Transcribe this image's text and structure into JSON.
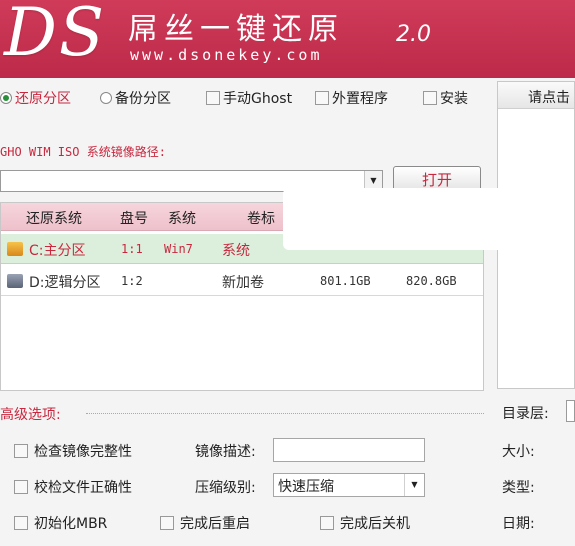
{
  "banner": {
    "logo": "DS",
    "app_title": "屌丝一键还原",
    "website": "www.dsonekey.com",
    "version": "2.0"
  },
  "modes": [
    {
      "label": "还原分区",
      "kind": "radio",
      "checked": true
    },
    {
      "label": "备份分区",
      "kind": "radio",
      "checked": false
    },
    {
      "label": "手动Ghost",
      "kind": "checkbox",
      "checked": false
    },
    {
      "label": "外置程序",
      "kind": "checkbox",
      "checked": false
    },
    {
      "label": "安装",
      "kind": "checkbox",
      "checked": false
    }
  ],
  "right_panel": {
    "title": "请点击"
  },
  "path": {
    "label": "GHO WIM ISO 系统镜像路径:",
    "value": "",
    "open_button": "打开"
  },
  "table": {
    "headers": [
      "还原系统",
      "盘号",
      "系统",
      "卷标"
    ],
    "rows": [
      {
        "name": "C:主分区",
        "disk": "1:1",
        "os": "Win7",
        "label": "系统",
        "size": "",
        "free": "",
        "selected": true,
        "icon": "drive-c-icon"
      },
      {
        "name": "D:逻辑分区",
        "disk": "1:2",
        "os": "",
        "label": "新加卷",
        "size": "801.1GB",
        "free": "820.8GB",
        "selected": false,
        "icon": "drive-d-icon"
      }
    ]
  },
  "advanced": {
    "title": "高级选项:",
    "check_integrity": "检查镜像完整性",
    "check_files": "校检文件正确性",
    "init_mbr": "初始化MBR",
    "restart_after": "完成后重启",
    "shutdown_after": "完成后关机",
    "desc_label": "镜像描述:",
    "desc_value": "",
    "compress_label": "压缩级别:",
    "compress_value": "快速压缩"
  },
  "side_info": {
    "dir_layer": "目录层:",
    "size": "大小:",
    "type": "类型:",
    "date": "日期:"
  },
  "colors": {
    "accent": "#c8283f",
    "banner": "#c3304f",
    "selected_row": "#dcefdc",
    "header_row": "#f2ccd5"
  }
}
